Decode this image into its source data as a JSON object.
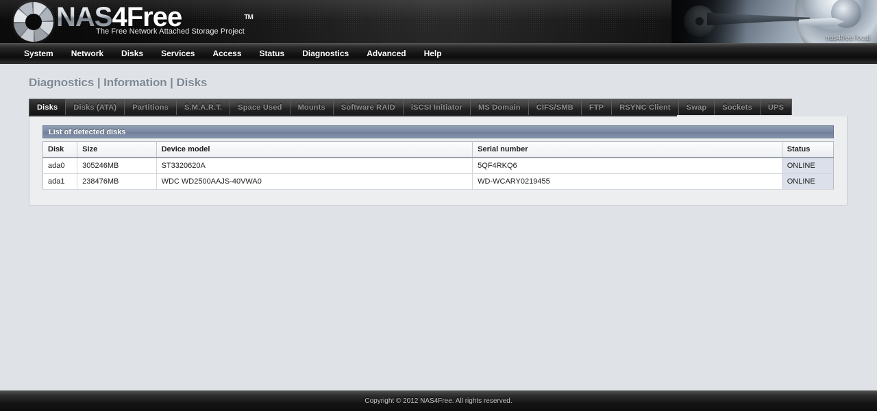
{
  "header": {
    "logo_name_prefix": "NAS",
    "logo_name_suffix": "4Free",
    "trademark": "TM",
    "tagline": "The Free Network Attached Storage Project",
    "hostname": "nas4free.local"
  },
  "nav": {
    "items": [
      {
        "label": "System"
      },
      {
        "label": "Network"
      },
      {
        "label": "Disks"
      },
      {
        "label": "Services"
      },
      {
        "label": "Access"
      },
      {
        "label": "Status"
      },
      {
        "label": "Diagnostics"
      },
      {
        "label": "Advanced"
      },
      {
        "label": "Help"
      }
    ]
  },
  "page": {
    "title": "Diagnostics | Information | Disks"
  },
  "tabs": [
    {
      "label": "Disks",
      "active": true
    },
    {
      "label": "Disks (ATA)",
      "active": false
    },
    {
      "label": "Partitions",
      "active": false
    },
    {
      "label": "S.M.A.R.T.",
      "active": false
    },
    {
      "label": "Space Used",
      "active": false
    },
    {
      "label": "Mounts",
      "active": false
    },
    {
      "label": "Software RAID",
      "active": false
    },
    {
      "label": "iSCSI Initiator",
      "active": false
    },
    {
      "label": "MS Domain",
      "active": false
    },
    {
      "label": "CIFS/SMB",
      "active": false
    },
    {
      "label": "FTP",
      "active": false
    },
    {
      "label": "RSYNC Client",
      "active": false
    },
    {
      "label": "Swap",
      "active": false
    },
    {
      "label": "Sockets",
      "active": false
    },
    {
      "label": "UPS",
      "active": false
    }
  ],
  "panel": {
    "section_title": "List of detected disks",
    "table": {
      "columns": [
        "Disk",
        "Size",
        "Device model",
        "Serial number",
        "Status"
      ],
      "rows": [
        {
          "disk": "ada0",
          "size": "305246MB",
          "model": "ST3320620A",
          "serial": "5QF4RKQ6",
          "status": "ONLINE"
        },
        {
          "disk": "ada1",
          "size": "238476MB",
          "model": "WDC WD2500AAJS-40VWA0",
          "serial": "WD-WCARY0219455",
          "status": "ONLINE"
        }
      ]
    }
  },
  "footer": {
    "copyright": "Copyright © 2012 NAS4Free. All rights reserved."
  },
  "colors": {
    "page_background": "#dfe3e8",
    "section_header_blue": "#7c8aa2",
    "status_cell": "#dbe0ea",
    "nav_dark": "#141414",
    "title_gray": "#7d8894"
  }
}
